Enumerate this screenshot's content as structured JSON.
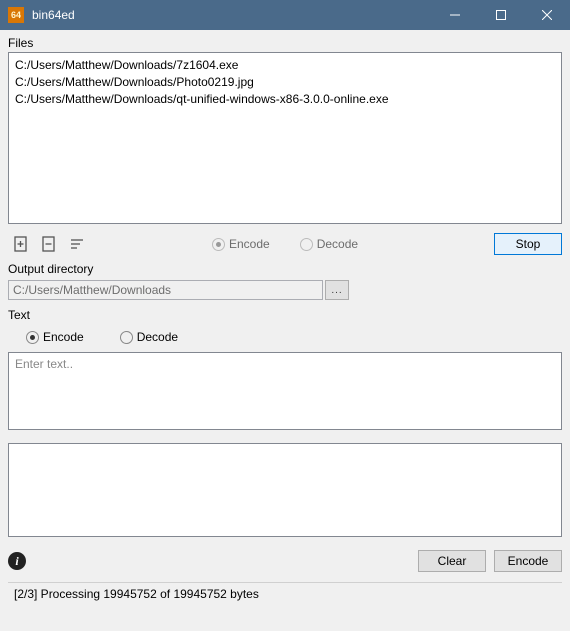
{
  "window": {
    "title": "bin64ed",
    "icon_text": "64"
  },
  "files": {
    "label": "Files",
    "items": [
      "C:/Users/Matthew/Downloads/7z1604.exe",
      "C:/Users/Matthew/Downloads/Photo0219.jpg",
      "C:/Users/Matthew/Downloads/qt-unified-windows-x86-3.0.0-online.exe"
    ]
  },
  "file_mode": {
    "encode_label": "Encode",
    "decode_label": "Decode",
    "selected": "encode",
    "enabled": false
  },
  "action_button": "Stop",
  "output_dir": {
    "label": "Output directory",
    "value": "C:/Users/Matthew/Downloads",
    "browse_label": "..."
  },
  "text_section": {
    "label": "Text",
    "encode_label": "Encode",
    "decode_label": "Decode",
    "selected": "encode",
    "input_placeholder": "Enter text..",
    "output_value": ""
  },
  "bottom": {
    "clear_label": "Clear",
    "encode_label": "Encode"
  },
  "status": "[2/3] Processing 19945752 of 19945752 bytes"
}
